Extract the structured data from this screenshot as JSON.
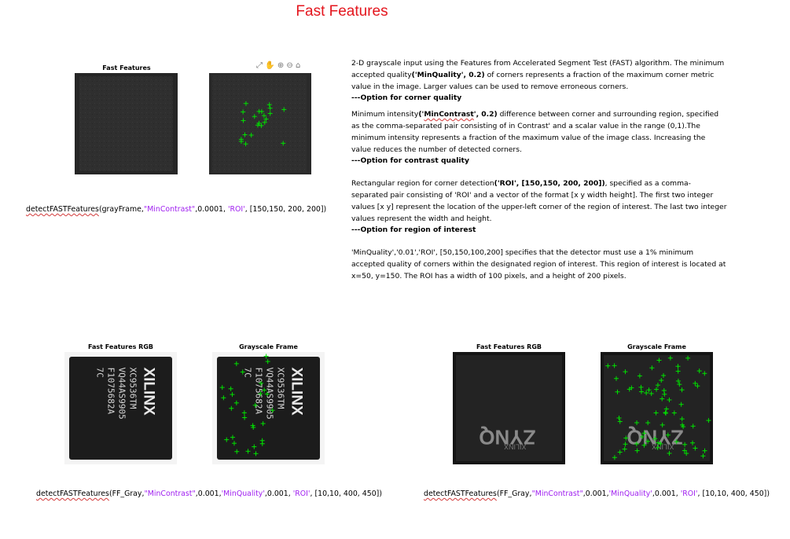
{
  "page_title": "Fast Features",
  "top": {
    "figure_title": "Fast Features",
    "code": {
      "func": "detectFASTFeatures",
      "arg": "(grayFrame,",
      "param1": "\"MinContrast\"",
      "val1": ",0.0001,",
      "param2": " 'ROI'",
      "val2": ", [150,150, 200, 200])"
    }
  },
  "toolbar": [
    "⤢",
    "✋",
    "⊕",
    "⊖",
    "⌂"
  ],
  "description": {
    "p1_lead": " 2-D grayscale input using the Features from Accelerated Segment Test (FAST) algorithm. The minimum accepted quality",
    "p1_param": "('MinQuality', 0.2)",
    "p1_rest": " of corners represents a fraction of the maximum corner metric value in the image. Larger values can be used to remove erroneous corners.",
    "p1_option": "---Option for corner quality",
    "p2_lead": "Minimum intensity",
    "p2_param_a": "('",
    "p2_param_word": "MinContrast",
    "p2_param_b": "', 0.2)",
    "p2_rest": " difference between corner and surrounding region, specified as the comma-separated pair consisting of in Contrast' and a scalar value in the range (0,1).The minimum intensity represents a fraction of the maximum value of the image class. Increasing the value reduces the number of detected corners.",
    "p2_option": "---Option for contrast quality",
    "p3_lead": "Rectangular region for corner detection",
    "p3_param": "('ROI', [150,150, 200, 200])",
    "p3_rest": ", specified as a comma-separated pair consisting of 'ROI' and a vector of the format [x y width height]. The first two integer values [x y] represent the location of the upper-left corner of the region of interest. The last two integer values represent the width and height.",
    "p3_option": "---Option for region of interest",
    "p4": "'MinQuality','0.01','ROI', [50,150,100,200] specifies that the detector must use a 1% minimum accepted quality of corners within the designated region of interest. This region of interest is located at x=50, y=150. The ROI has a width of 100 pixels, and a height of 200 pixels."
  },
  "bottom_left": {
    "title_rgb": "Fast Features RGB",
    "title_gray": "Grayscale Frame",
    "chip_brand": "XILINX",
    "chip_lines": [
      "XC9536TM",
      "VQ44AS9905",
      "F1075682A",
      "7C"
    ],
    "code": {
      "func": "detectFASTFeatures",
      "arg": "(FF_Gray,",
      "param1": "\"MinContrast\"",
      "val1": ",0.001,",
      "param2": "'MinQuality'",
      "val2": ",0.001,  ",
      "param3": "'ROI'",
      "val3": ", [10,10, 400, 450])"
    }
  },
  "bottom_right": {
    "title_rgb": "Fast Features RGB",
    "title_gray": "Grayscale Frame",
    "chip_brand": "ZYNQ",
    "chip_sub": "XILINX",
    "code": {
      "func": "detectFASTFeatures",
      "arg": "(FF_Gray,",
      "param1": "\"MinContrast\"",
      "val1": ",0.001,",
      "param2": "'MinQuality'",
      "val2": ",0.001,  ",
      "param3": "'ROI'",
      "val3": ", [10,10, 400, 450])"
    }
  },
  "colors": {
    "title": "#e4151d",
    "string": "#a020f0",
    "marker": "#00e000"
  }
}
